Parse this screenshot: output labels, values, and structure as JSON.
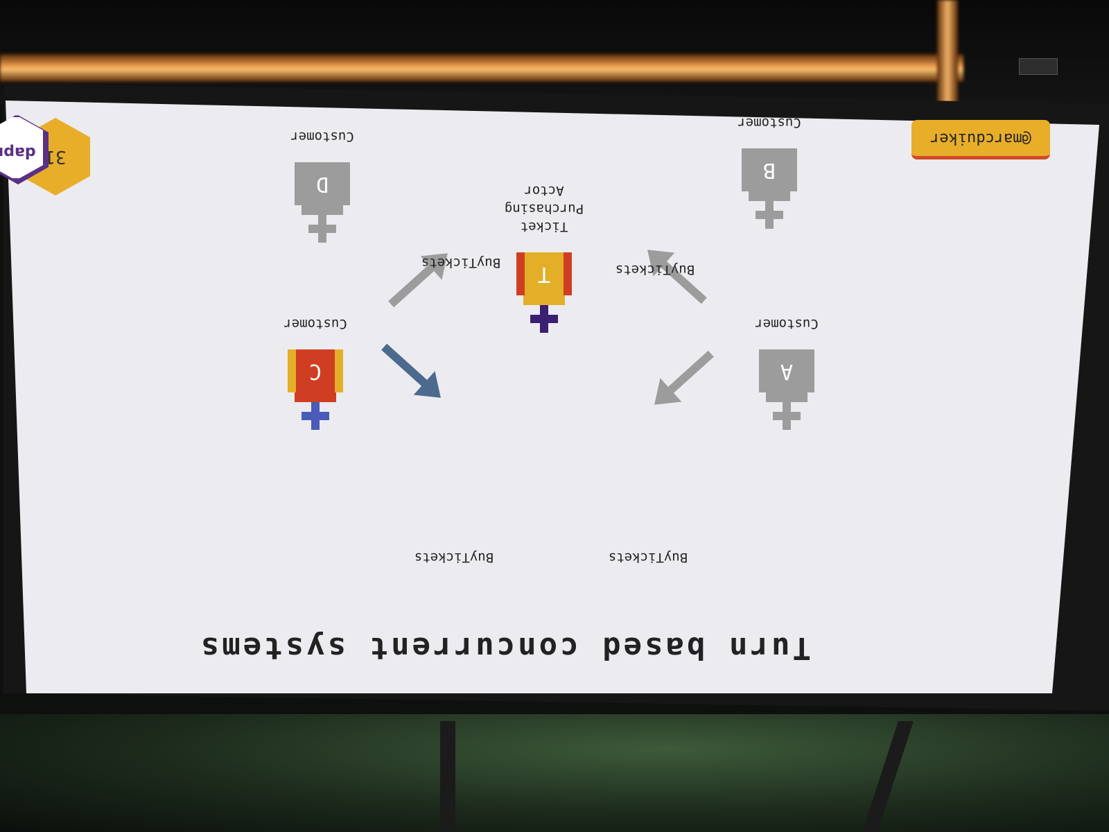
{
  "slide": {
    "title": "Turn based concurrent systems",
    "twitter_handle": "@marcduiker",
    "page_number": "31",
    "logo_text": "dapr",
    "center_actor": {
      "letter": "T",
      "caption_line1": "Ticket",
      "caption_line2": "Purchasing",
      "caption_line3": "Actor"
    },
    "customers": [
      {
        "letter": "A",
        "label": "Customer",
        "state": "inactive"
      },
      {
        "letter": "B",
        "label": "Customer",
        "state": "inactive"
      },
      {
        "letter": "C",
        "label": "Customer",
        "state": "active"
      },
      {
        "letter": "D",
        "label": "Customer",
        "state": "inactive"
      }
    ],
    "message_label": "BuyTickets",
    "colors": {
      "inactive": "#9c9c9c",
      "active_box": "#cf3e22",
      "active_stripe": "#e3ae28",
      "active_head": "#4a5bb8",
      "active_arrow": "#4b6a8e",
      "center_box": "#e3ae28",
      "center_stripe": "#cf3e22",
      "center_head": "#3b1f72",
      "background": "#ecebef"
    }
  }
}
